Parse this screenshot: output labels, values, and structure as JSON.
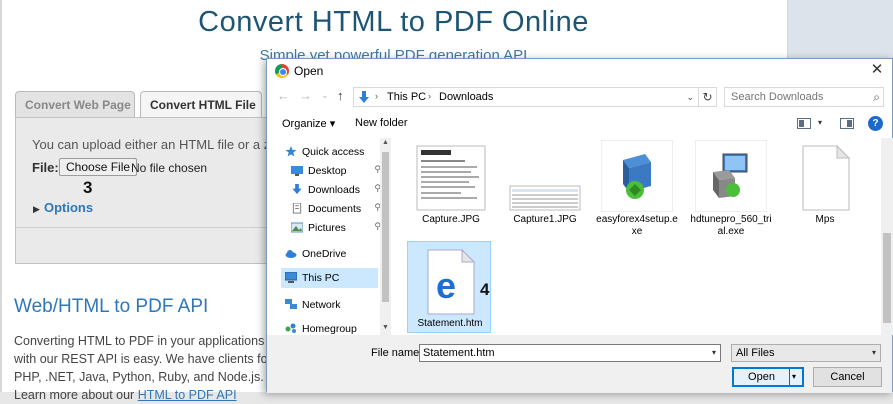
{
  "webpage": {
    "title": "Convert HTML to PDF Online",
    "subtitle": "Simple yet powerful PDF generation API",
    "tabs": [
      {
        "label": "Convert Web Page"
      },
      {
        "label": "Convert HTML File"
      }
    ],
    "upload_text": "You can upload either an HTML file or a zip",
    "file_label": "File:",
    "choose_file_label": "Choose File",
    "no_file_text": "No file chosen",
    "step_marker": "3",
    "options_arrow": "▶",
    "options_label": "Options",
    "api_heading": "Web/HTML to PDF API",
    "api_paragraph": {
      "line1": "Converting HTML to PDF in your applications",
      "line2": "with our REST API is easy. We have clients for",
      "line3": "PHP, .NET, Java, Python, Ruby, and Node.js.",
      "line4_prefix": "Learn more about our ",
      "line4_link": "HTML to PDF API"
    }
  },
  "dialog": {
    "title": "Open",
    "close_glyph": "✕",
    "nav": {
      "back_glyph": "←",
      "forward_glyph": "→",
      "recent_glyph": "⌄",
      "up_glyph": "↑",
      "separator_glyph": "›",
      "breadcrumbs": [
        "This PC",
        "Downloads"
      ],
      "dropdown_glyph": "⌄",
      "refresh_glyph": "↻",
      "search_placeholder": "Search Downloads",
      "search_glyph": "⌕"
    },
    "toolbar": {
      "organize_label": "Organize ▾",
      "new_folder_label": "New folder",
      "view_dropdown_glyph": "▾",
      "help_glyph": "?"
    },
    "sidebar": {
      "items": [
        {
          "label": "Quick access",
          "pinned": false
        },
        {
          "label": "Desktop",
          "pinned": true
        },
        {
          "label": "Downloads",
          "pinned": true
        },
        {
          "label": "Documents",
          "pinned": true
        },
        {
          "label": "Pictures",
          "pinned": true
        },
        {
          "label": "OneDrive",
          "pinned": false
        },
        {
          "label": "This PC",
          "pinned": false,
          "selected": true
        },
        {
          "label": "Network",
          "pinned": false
        },
        {
          "label": "Homegroup",
          "pinned": false
        }
      ],
      "pin_glyph": "📌",
      "scroll_up_glyph": "▲",
      "scroll_down_glyph": "▼"
    },
    "files": [
      {
        "name": "Capture.JPG",
        "icon": "image-thumbnail"
      },
      {
        "name": "Capture1.JPG",
        "icon": "image-thumbnail"
      },
      {
        "name": "easyforex4setup.exe",
        "icon": "installer-icon"
      },
      {
        "name": "hdtunepro_560_trial.exe",
        "icon": "installer-icon"
      },
      {
        "name": "Mps",
        "icon": "blank-file-icon"
      },
      {
        "name": "Statement.htm",
        "icon": "edge-html-icon",
        "selected": true
      }
    ],
    "step_marker": "4",
    "filename_label": "File name:",
    "filename_value": "Statement.htm",
    "filetype_value": "All Files",
    "open_label": "Open",
    "cancel_label": "Cancel",
    "dropdown_glyph": "▾"
  },
  "colors": {
    "accent": "#0078d7",
    "selection": "#cce8ff",
    "title_blue": "#1f5574",
    "link_blue": "#2e77b8"
  }
}
